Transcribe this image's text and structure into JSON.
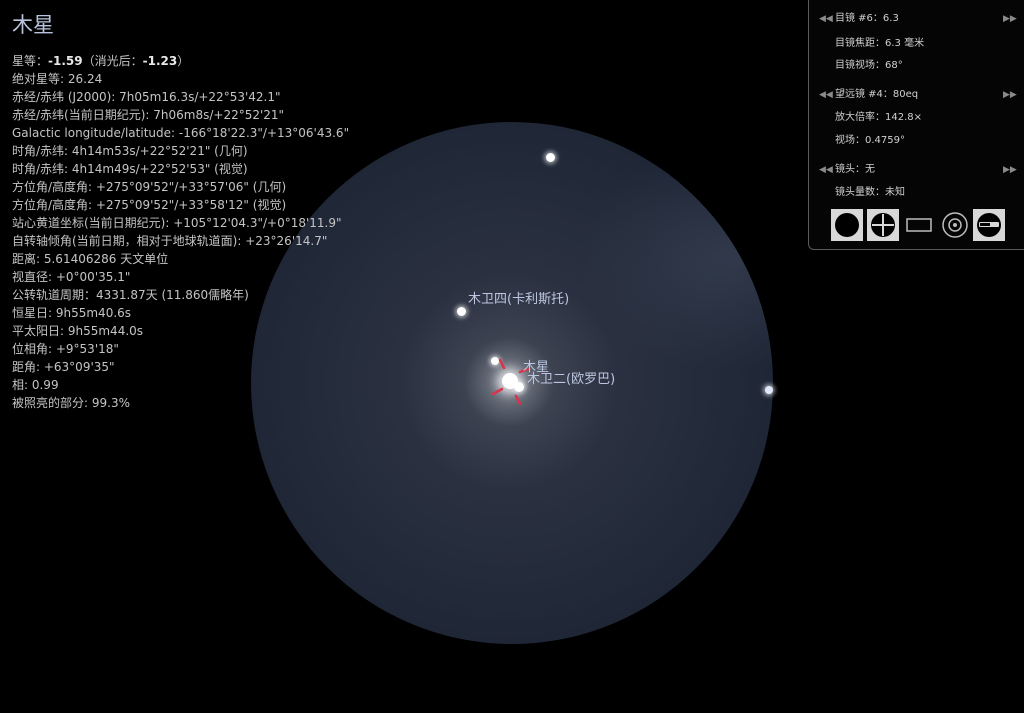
{
  "object": {
    "title": "木星",
    "lines": [
      {
        "label": "星等：",
        "bold": "-1.59",
        "rest": "（消光后：",
        "bold2": "-1.23",
        "end": "）"
      },
      {
        "text": "绝对星等: 26.24"
      },
      {
        "text": "赤经/赤纬 (J2000): 7h05m16.3s/+22°53'42.1\""
      },
      {
        "text": "赤经/赤纬(当前日期纪元): 7h06m8s/+22°52'21\""
      },
      {
        "text": "Galactic longitude/latitude: -166°18'22.3\"/+13°06'43.6\""
      },
      {
        "text": "时角/赤纬: 4h14m53s/+22°52'21\" (几何)"
      },
      {
        "text": "时角/赤纬: 4h14m49s/+22°52'53\" (视觉)"
      },
      {
        "text": "方位角/高度角: +275°09'52\"/+33°57'06\" (几何)"
      },
      {
        "text": "方位角/高度角: +275°09'52\"/+33°58'12\" (视觉)"
      },
      {
        "text": "站心黄道坐标(当前日期纪元): +105°12'04.3\"/+0°18'11.9\""
      },
      {
        "text": "自转轴倾角(当前日期，相对于地球轨道面): +23°26'14.7\""
      },
      {
        "text": "距离: 5.61406286 天文单位"
      },
      {
        "text": "视直径: +0°00'35.1\""
      },
      {
        "text": "公转轨道周期：4331.87天 (11.860儒略年)"
      },
      {
        "text": "恒星日: 9h55m40.6s"
      },
      {
        "text": "平太阳日: 9h55m44.0s"
      },
      {
        "text": "位相角: +9°53'18\""
      },
      {
        "text": "距角: +63°09'35\""
      },
      {
        "text": "相: 0.99"
      },
      {
        "text": "被照亮的部分: 99.3%"
      }
    ]
  },
  "view_labels": {
    "callisto": "木卫四(卡利斯托)",
    "jupiter": "木星",
    "europa": "木卫二(欧罗巴)"
  },
  "ocular_panel": {
    "eyepiece": "目镜 #6：6.3",
    "eyepiece_focal": "目镜焦距：6.3 毫米",
    "eyepiece_fov": "目镜视场：68°",
    "telescope": "望远镜 #4：80eq",
    "magnification": "放大倍率：142.8×",
    "fov": "视场：0.4759°",
    "lens": "镜头：无",
    "lens_multiplier": "镜头量数：未知",
    "tools": [
      "ocular-view",
      "crosshair",
      "sensor-frame",
      "telrad",
      "telescope-config"
    ]
  },
  "colors": {
    "background": "#000000",
    "fov_edge": "#1f2636",
    "reticle": "#e0304a",
    "label": "#bcc6e0"
  }
}
